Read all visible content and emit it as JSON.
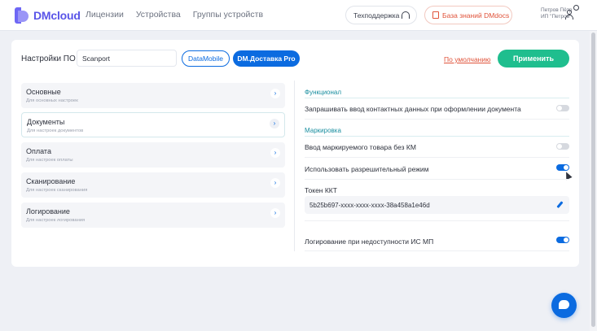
{
  "header": {
    "logo_text": "DMcloud",
    "nav": [
      "Лицензии",
      "Устройства",
      "Группы устройств"
    ],
    "support_label": "Техподдержка",
    "knowledge_base_label": "База знаний DMdocs",
    "user_name": "Петров Пётр",
    "user_org": "ИП \"Петров\""
  },
  "toolbar": {
    "settings_label": "Настройки ПО",
    "profile_value": "Scanport",
    "tab_datamobile": "DataMobile",
    "tab_delivery": "DM.Доставка Pro",
    "default_link": "По умолчанию",
    "apply_label": "Применить"
  },
  "sidebar": {
    "items": [
      {
        "title": "Основные",
        "subtitle": "Для основных настроек"
      },
      {
        "title": "Документы",
        "subtitle": "Для настроек документов"
      },
      {
        "title": "Оплата",
        "subtitle": "Для настроек оплаты"
      },
      {
        "title": "Сканирование",
        "subtitle": "Для настроек сканирования"
      },
      {
        "title": "Логирование",
        "subtitle": "Для настроек логирования"
      }
    ],
    "active_index": 1
  },
  "panel": {
    "section_functional": "Функционал",
    "row_contact": "Запрашивать ввод контактных данных при оформлении документа",
    "section_marking": "Маркировка",
    "row_marked_input": "Ввод маркируемого товара без КМ",
    "row_permit_mode": "Использовать разрешительный режим",
    "token_label": "Токен ККТ",
    "token_value": "5b25b697-xxxx-xxxx-xxxx-38a458a1e46d",
    "row_logging": "Логирование при недоступности ИС МП",
    "toggles": {
      "contact": false,
      "marked_input": false,
      "permit_mode": true,
      "logging": true
    }
  },
  "colors": {
    "primary": "#0b6be0",
    "success": "#1fbe8e",
    "accent_red": "#e0533a",
    "section_teal": "#1a8fa0"
  }
}
